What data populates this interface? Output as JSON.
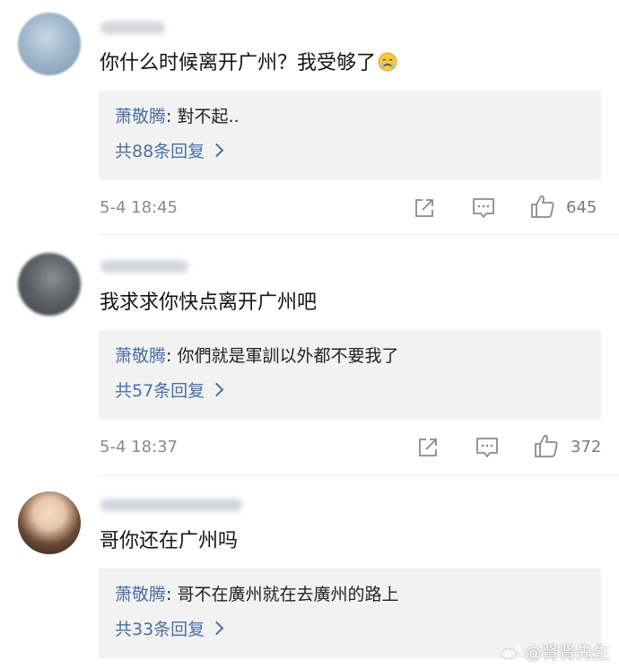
{
  "comments": [
    {
      "text": "你什么时候离开广州？我受够了",
      "emoji": "crying-face-emoji",
      "reply": {
        "author": "萧敬腾",
        "separator": ": ",
        "text": "對不起..",
        "more": "共88条回复"
      },
      "time": "5-4 18:45",
      "likes": "645"
    },
    {
      "text": "我求求你快点离开广州吧",
      "reply": {
        "author": "萧敬腾",
        "separator": ": ",
        "text": "你們就是軍訓以外都不要我了",
        "more": "共57条回复"
      },
      "time": "5-4 18:37",
      "likes": "372"
    },
    {
      "text": "哥你还在广州吗",
      "reply": {
        "author": "萧敬腾",
        "separator": ": ",
        "text": "哥不在廣州就在去廣州的路上",
        "more": "共33条回复"
      }
    }
  ],
  "watermark": "@肾肾先生",
  "colors": {
    "link": "#4b6fa3",
    "reply_bg": "#f2f2f2",
    "meta": "#8a8a8a"
  }
}
